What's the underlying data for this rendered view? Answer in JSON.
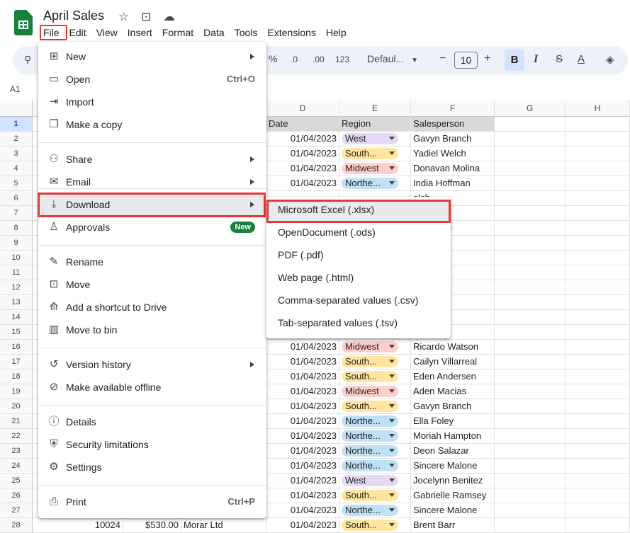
{
  "doc": {
    "title": "April Sales",
    "star_icon": "star-icon",
    "folder_icon": "move-folder-icon",
    "cloud_icon": "cloud-icon"
  },
  "menubar": [
    "File",
    "Edit",
    "View",
    "Insert",
    "Format",
    "Data",
    "Tools",
    "Extensions",
    "Help"
  ],
  "toolbar": {
    "percent": "%",
    "dec_less": ".0",
    "dec_more": ".00",
    "num_format": "123",
    "font": "Defaul...",
    "minus": "−",
    "size": "10",
    "plus": "+",
    "bold": "B",
    "italic": "I",
    "strike": "S",
    "text_color": "A"
  },
  "name_box": "A1",
  "columns": [
    "D",
    "E",
    "F",
    "G",
    "H"
  ],
  "header_row": {
    "d": "Date",
    "e": "Region",
    "f": "Salesperson"
  },
  "rows": [
    {
      "n": "1"
    },
    {
      "n": "2",
      "d": "01/04/2023",
      "e": "West",
      "f": "Gavyn Branch"
    },
    {
      "n": "3",
      "d": "01/04/2023",
      "e": "South...",
      "f": "Yadiel Welch"
    },
    {
      "n": "4",
      "d": "01/04/2023",
      "e": "Midwest",
      "f": "Donavan Molina"
    },
    {
      "n": "5",
      "d": "01/04/2023",
      "e": "Northe...",
      "f": "India Hoffman"
    },
    {
      "n": "6",
      "f": "elch"
    },
    {
      "n": "7",
      "f": "ay"
    },
    {
      "n": "8",
      "f": "Browning"
    },
    {
      "n": "9",
      "f": "brera"
    },
    {
      "n": "10",
      "f": "rza"
    },
    {
      "n": "11",
      "f": "mmers"
    },
    {
      "n": "12",
      "f": "ranch"
    },
    {
      "n": "13",
      "f": "Stevens"
    },
    {
      "n": "14",
      "f": "yers"
    },
    {
      "n": "15",
      "f": "olon"
    },
    {
      "n": "16",
      "d": "01/04/2023",
      "e": "Midwest",
      "f": "Ricardo Watson"
    },
    {
      "n": "17",
      "d": "01/04/2023",
      "e": "South...",
      "f": "Cailyn Villarreal"
    },
    {
      "n": "18",
      "d": "01/04/2023",
      "e": "South...",
      "f": "Eden Andersen"
    },
    {
      "n": "19",
      "d": "01/04/2023",
      "e": "Midwest",
      "f": "Aden Macias"
    },
    {
      "n": "20",
      "d": "01/04/2023",
      "e": "South...",
      "f": "Gavyn Branch"
    },
    {
      "n": "21",
      "d": "01/04/2023",
      "e": "Northe...",
      "f": "Ella Foley"
    },
    {
      "n": "22",
      "d": "01/04/2023",
      "e": "Northe...",
      "f": "Moriah Hampton"
    },
    {
      "n": "23",
      "d": "01/04/2023",
      "e": "Northe...",
      "f": "Deon Salazar"
    },
    {
      "n": "24",
      "d": "01/04/2023",
      "e": "Northe...",
      "f": "Sincere Malone"
    },
    {
      "n": "25",
      "d": "01/04/2023",
      "e": "West",
      "f": "Jocelynn Benitez"
    },
    {
      "n": "26",
      "d": "01/04/2023",
      "e": "South...",
      "f": "Gabrielle Ramsey"
    },
    {
      "n": "27",
      "d": "01/04/2023",
      "e": "Northe...",
      "f": "Sincere Malone"
    },
    {
      "n": "28",
      "a": "10024",
      "b": "$530.00",
      "c": "Morar Ltd",
      "d": "01/04/2023",
      "e": "South...",
      "f": "Brent Barr"
    }
  ],
  "chip_colors": {
    "West": "#e6d9f5",
    "South...": "#ffe5a0",
    "Midwest": "#ffcfc9",
    "Northe...": "#bfe1f6"
  },
  "file_menu": {
    "items": [
      {
        "label": "New",
        "icon": "new-plus-icon",
        "arrow": true
      },
      {
        "label": "Open",
        "icon": "open-folder-icon",
        "shortcut": "Ctrl+O"
      },
      {
        "label": "Import",
        "icon": "import-icon"
      },
      {
        "label": "Make a copy",
        "icon": "copy-icon"
      },
      {
        "label": "Share",
        "icon": "share-person-icon",
        "arrow": true
      },
      {
        "label": "Email",
        "icon": "email-icon",
        "arrow": true
      },
      {
        "label": "Download",
        "icon": "download-icon",
        "arrow": true
      },
      {
        "label": "Approvals",
        "icon": "approvals-icon",
        "badge": "New"
      },
      {
        "label": "Rename",
        "icon": "rename-pencil-icon"
      },
      {
        "label": "Move",
        "icon": "move-folder-icon"
      },
      {
        "label": "Add a shortcut to Drive",
        "icon": "drive-shortcut-icon"
      },
      {
        "label": "Move to bin",
        "icon": "trash-icon"
      },
      {
        "label": "Version history",
        "icon": "history-icon",
        "arrow": true
      },
      {
        "label": "Make available offline",
        "icon": "offline-check-icon"
      },
      {
        "label": "Details",
        "icon": "info-icon"
      },
      {
        "label": "Security limitations",
        "icon": "shield-lock-icon"
      },
      {
        "label": "Settings",
        "icon": "gear-icon"
      },
      {
        "label": "Print",
        "icon": "printer-icon",
        "shortcut": "Ctrl+P"
      }
    ]
  },
  "download_menu": [
    "Microsoft Excel (.xlsx)",
    "OpenDocument (.ods)",
    "PDF (.pdf)",
    "Web page (.html)",
    "Comma-separated values (.csv)",
    "Tab-separated values (.tsv)"
  ]
}
